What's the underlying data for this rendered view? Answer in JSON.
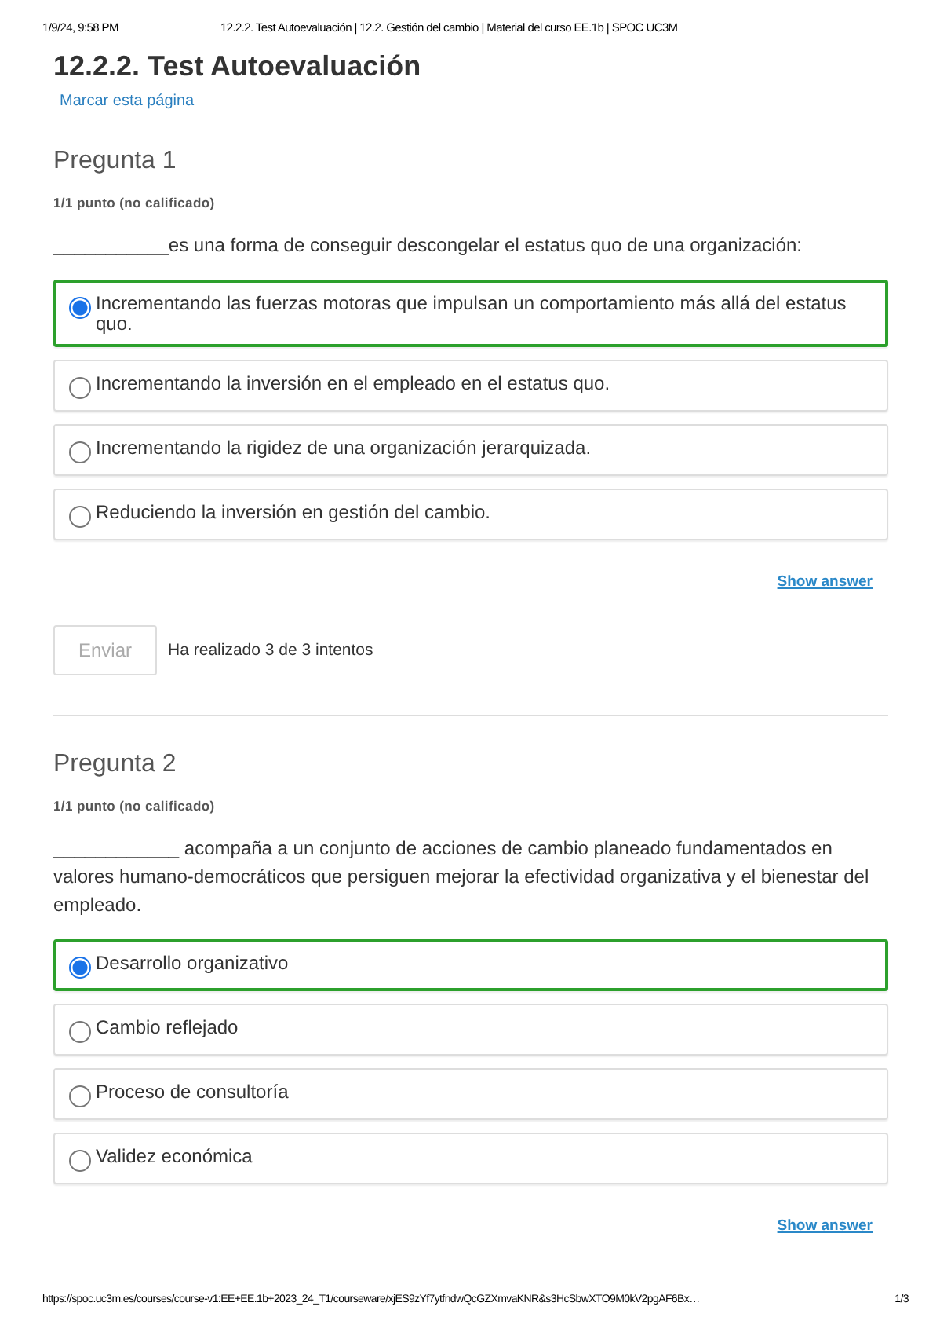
{
  "print_header": {
    "date": "1/9/24, 9:58 PM",
    "title": "12.2.2. Test Autoevaluación | 12.2. Gestión del cambio | Material del curso EE.1b | SPOC UC3M"
  },
  "page_title": "12.2.2. Test Autoevaluación",
  "bookmark_link": "Marcar esta página",
  "questions": [
    {
      "heading": "Pregunta 1",
      "points": "1/1 punto (no calificado)",
      "prompt": "___________es una forma de conseguir descongelar el estatus quo de una organización:",
      "options": [
        {
          "label": "Incrementando las fuerzas motoras que impulsan un comportamiento más allá del estatus quo.",
          "selected": true
        },
        {
          "label": "Incrementando la inversión en el empleado en el estatus quo.",
          "selected": false
        },
        {
          "label": "Incrementando la rigidez de una organización jerarquizada.",
          "selected": false
        },
        {
          "label": "Reduciendo la inversión en gestión del cambio.",
          "selected": false
        }
      ],
      "show_answer": "Show answer",
      "submit": {
        "label": "Enviar",
        "disabled": true
      },
      "attempts": "Ha realizado 3 de 3 intentos"
    },
    {
      "heading": "Pregunta 2",
      "points": "1/1 punto (no calificado)",
      "prompt": "____________ acompaña a un conjunto de acciones de cambio planeado fundamentados en valores humano-democráticos que persiguen mejorar la efectividad organizativa y el bienestar del empleado.",
      "options": [
        {
          "label": "Desarrollo organizativo",
          "selected": true
        },
        {
          "label": "Cambio reflejado",
          "selected": false
        },
        {
          "label": "Proceso de consultoría",
          "selected": false
        },
        {
          "label": "Validez económica",
          "selected": false
        }
      ],
      "show_answer": "Show answer"
    }
  ],
  "print_footer": {
    "url": "https://spoc.uc3m.es/courses/course-v1:EE+EE.1b+2023_24_T1/courseware/xjES9zYf7ytfndwQcGZXmvaKNR&s3HcSbwXTO9M0kV2pgAF6Bx…",
    "page": "1/3"
  }
}
